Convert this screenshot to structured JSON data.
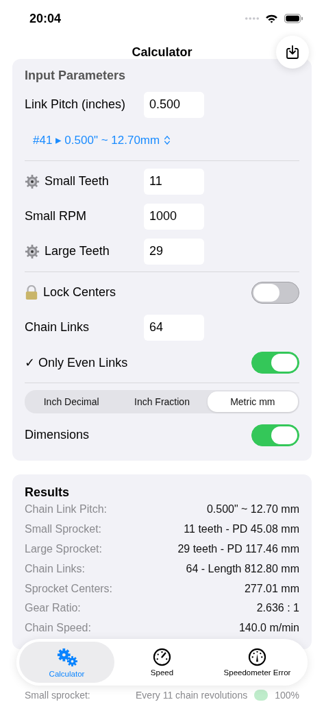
{
  "status_bar": {
    "time": "20:04"
  },
  "nav": {
    "title": "Calculator"
  },
  "input_parameters": {
    "title": "Input Parameters",
    "groups": [
      [
        {
          "kind": "field",
          "label": "Link Pitch (inches)",
          "value": "0.500",
          "icon": false
        },
        {
          "kind": "picker",
          "text": "#41 ▸ 0.500\" ~ 12.70mm"
        }
      ],
      [
        {
          "kind": "field",
          "label": "Small Teeth",
          "value": "11",
          "icon": true
        },
        {
          "kind": "field",
          "label": "Small RPM",
          "value": "1000",
          "icon": false
        },
        {
          "kind": "field",
          "label": "Large Teeth",
          "value": "29",
          "icon": true
        }
      ],
      [
        {
          "kind": "toggle",
          "label": "Lock Centers",
          "on": false,
          "icon": true
        },
        {
          "kind": "field",
          "label": "Chain Links",
          "value": "64",
          "icon": false
        },
        {
          "kind": "toggle",
          "label": "✓ Only Even Links",
          "on": true,
          "icon": false
        }
      ],
      [
        {
          "kind": "segmented",
          "options": [
            {
              "label": "Inch Decimal",
              "selected": false
            },
            {
              "label": "Inch Fraction",
              "selected": false
            },
            {
              "label": "Metric mm",
              "selected": true
            }
          ]
        },
        {
          "kind": "toggle",
          "label": "Dimensions",
          "on": true,
          "icon": false
        }
      ]
    ]
  },
  "results": {
    "title": "Results",
    "rows": [
      {
        "label": "Chain Link Pitch:",
        "value": "0.500\" ~ 12.70 mm"
      },
      {
        "label": "Small Sprocket:",
        "value": "11 teeth - PD 45.08 mm"
      },
      {
        "label": "Large Sprocket:",
        "value": "29 teeth - PD 117.46 mm"
      },
      {
        "label": "Chain Links:",
        "value": "64 - Length 812.80 mm"
      },
      {
        "label": "Sprocket Centers:",
        "value": "277.01 mm"
      },
      {
        "label": "Gear Ratio:",
        "value": "2.636 : 1"
      },
      {
        "label": "Chain Speed:",
        "value": "140.0 m/min"
      }
    ]
  },
  "next_row": {
    "label": "Small sprocket:",
    "value": "Every 11 chain revolutions",
    "percent": "100%"
  },
  "tab_bar": [
    {
      "label": "Calculator",
      "selected": true
    },
    {
      "label": "Speed",
      "selected": false
    },
    {
      "label": "Speedometer Error",
      "selected": false
    }
  ]
}
